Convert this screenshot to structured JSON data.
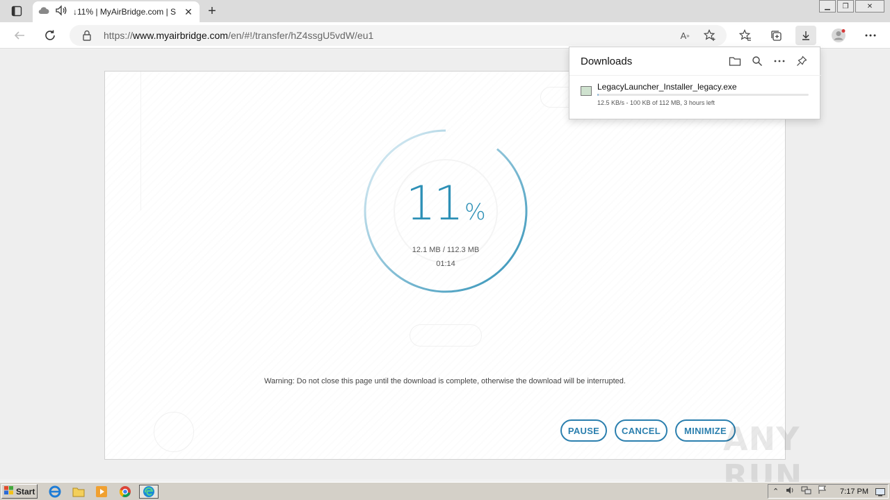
{
  "browser": {
    "tab_title": "↓11% | MyAirBridge.com | S",
    "url_prefix": "https://",
    "url_domain": "www.myairbridge.com",
    "url_path": "/en/#!/transfer/hZ4ssgU5vdW/eu1"
  },
  "icons": {
    "tab_actions": "tab-actions-icon",
    "favicon": "cloud-icon",
    "audio": "speaker-icon",
    "back": "arrow-left-icon",
    "reload": "reload-icon",
    "lock": "lock-icon",
    "read_aloud": "read-aloud-icon",
    "add_favorite": "star-plus-icon",
    "favorites": "favorites-icon",
    "collections": "collections-icon",
    "downloads": "download-icon",
    "profile": "avatar-icon",
    "menu": "more-icon"
  },
  "transfer": {
    "percent_value": 0.11,
    "percent_number": "11",
    "percent_symbol": "%",
    "sizes": "12.1 MB / 112.3 MB",
    "elapsed": "01:14",
    "warning": "Warning: Do not close this page until the download is complete, otherwise the download will be interrupted.",
    "buttons": {
      "pause": "PAUSE",
      "cancel": "CANCEL",
      "minimize": "MINIMIZE"
    },
    "accent_color": "#2d90b6"
  },
  "downloads_panel": {
    "title": "Downloads",
    "file_name": "LegacyLauncher_Installer_legacy.exe",
    "status": "12.5 KB/s - 100 KB of 112 MB, 3 hours left",
    "progress_fraction": 0.001
  },
  "watermark": "ANY RUN",
  "taskbar": {
    "start_label": "Start",
    "clock": "7:17 PM"
  }
}
